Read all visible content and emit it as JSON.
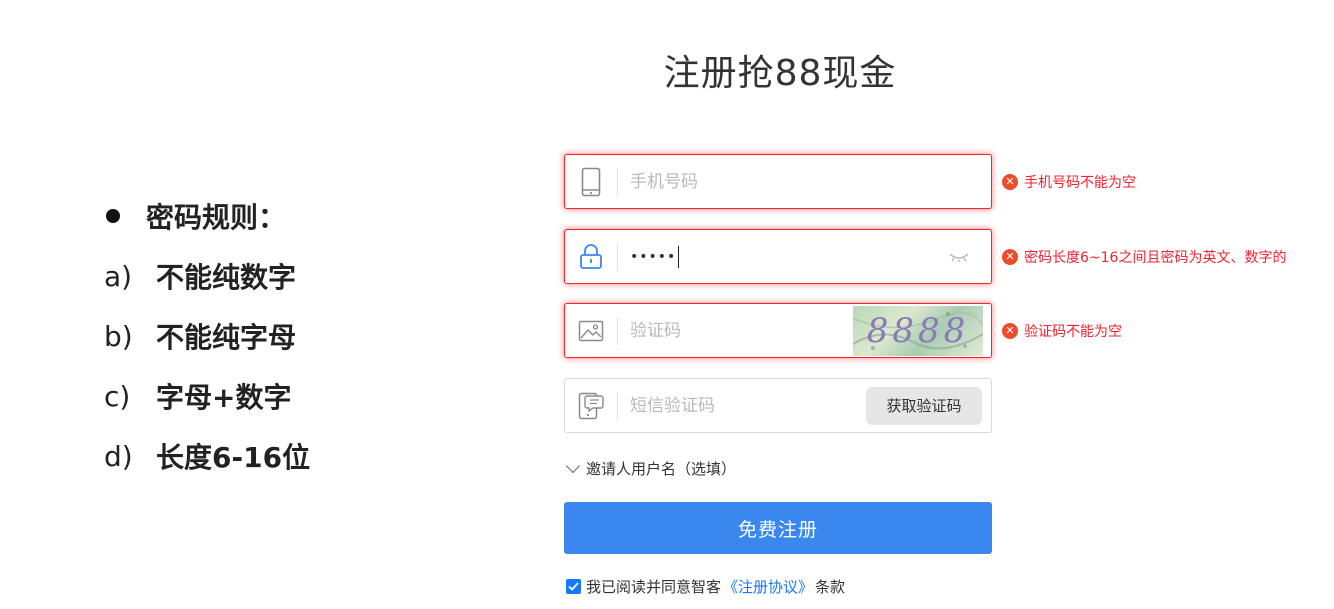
{
  "rules": {
    "title": "密码规则：",
    "items": [
      {
        "marker": "a)",
        "text": "不能纯数字"
      },
      {
        "marker": "b)",
        "text": "不能纯字母"
      },
      {
        "marker": "c)",
        "text": "字母+数字"
      },
      {
        "marker": "d)",
        "text": "长度6-16位"
      }
    ]
  },
  "form": {
    "title": "注册抢88现金",
    "phone": {
      "placeholder": "手机号码",
      "error": "手机号码不能为空"
    },
    "password": {
      "masked_value": "•••••",
      "error": "密码长度6~16之间且密码为英文、数字的"
    },
    "captcha": {
      "placeholder": "验证码",
      "image_text": "8888",
      "error": "验证码不能为空"
    },
    "sms": {
      "placeholder": "短信验证码",
      "button_label": "获取验证码"
    },
    "inviter_label": "邀请人用户名（选填）",
    "submit_label": "免费注册",
    "agreement": {
      "prefix": "我已阅读并同意智客",
      "link": "《注册协议》",
      "suffix": "条款",
      "checked": true
    }
  },
  "colors": {
    "primary": "#3a87f0",
    "error": "#f5222d",
    "link": "#1677ff"
  }
}
